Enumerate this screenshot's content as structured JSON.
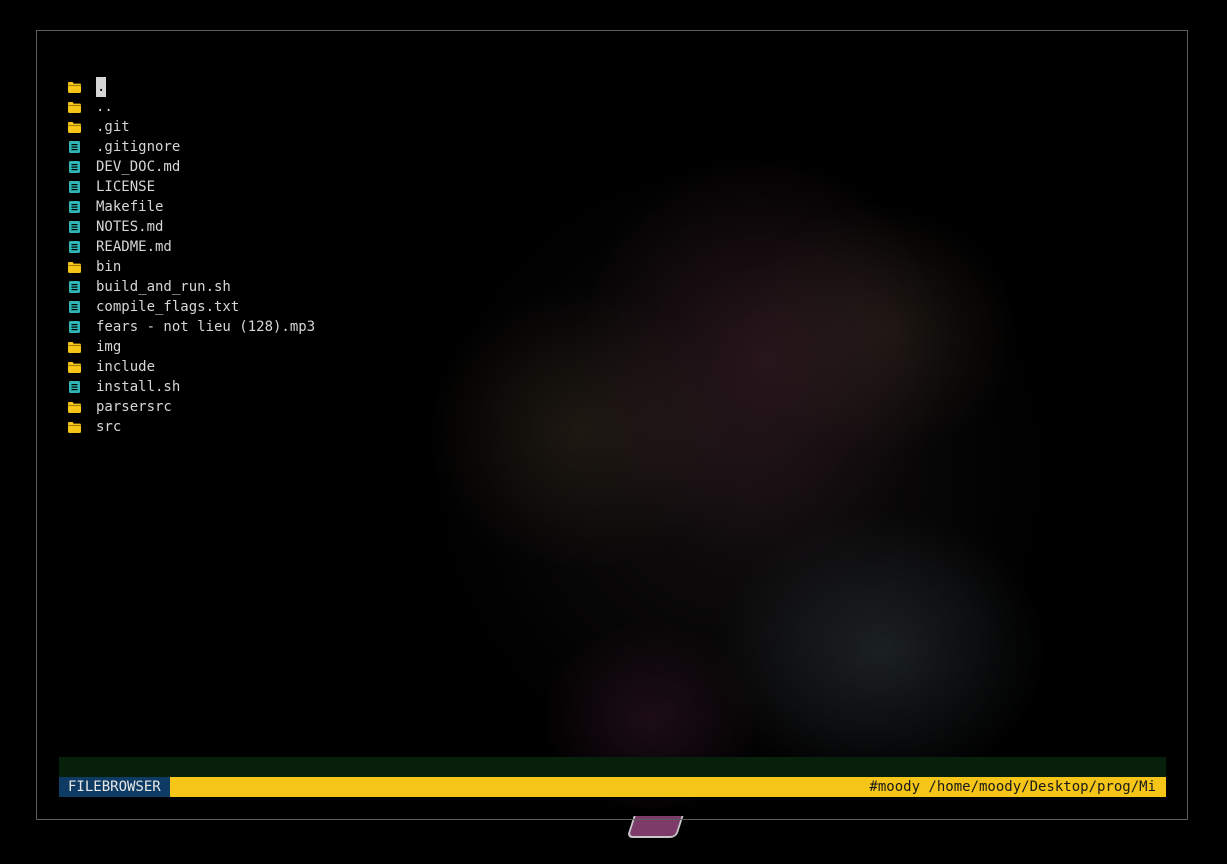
{
  "files": [
    {
      "name": ".",
      "type": "dir",
      "icon": "folder-icon"
    },
    {
      "name": "..",
      "type": "dir",
      "icon": "folder-icon"
    },
    {
      "name": ".git",
      "type": "dir",
      "icon": "folder-icon"
    },
    {
      "name": ".gitignore",
      "type": "file",
      "icon": "file-icon"
    },
    {
      "name": "DEV_DOC.md",
      "type": "file",
      "icon": "file-icon"
    },
    {
      "name": "LICENSE",
      "type": "file",
      "icon": "file-icon"
    },
    {
      "name": "Makefile",
      "type": "file",
      "icon": "file-icon"
    },
    {
      "name": "NOTES.md",
      "type": "file",
      "icon": "file-icon"
    },
    {
      "name": "README.md",
      "type": "file",
      "icon": "file-icon"
    },
    {
      "name": "bin",
      "type": "dir",
      "icon": "folder-icon"
    },
    {
      "name": "build_and_run.sh",
      "type": "file",
      "icon": "file-icon"
    },
    {
      "name": "compile_flags.txt",
      "type": "file",
      "icon": "file-icon"
    },
    {
      "name": "fears - not lieu (128).mp3",
      "type": "file",
      "icon": "file-icon"
    },
    {
      "name": "img",
      "type": "dir",
      "icon": "folder-icon"
    },
    {
      "name": "include",
      "type": "dir",
      "icon": "folder-icon"
    },
    {
      "name": "install.sh",
      "type": "file",
      "icon": "file-icon"
    },
    {
      "name": "parsersrc",
      "type": "dir",
      "icon": "folder-icon"
    },
    {
      "name": "src",
      "type": "dir",
      "icon": "folder-icon"
    }
  ],
  "cursor_index": 0,
  "statusbar": {
    "mode": "FILEBROWSER",
    "path": "#moody /home/moody/Desktop/prog/Mi"
  },
  "colors": {
    "folder": "#f5c518",
    "file": "#2fb5b5",
    "statusbar": "#f5c518",
    "mode_bg": "#0e3b63",
    "command_line": "#06200b"
  }
}
